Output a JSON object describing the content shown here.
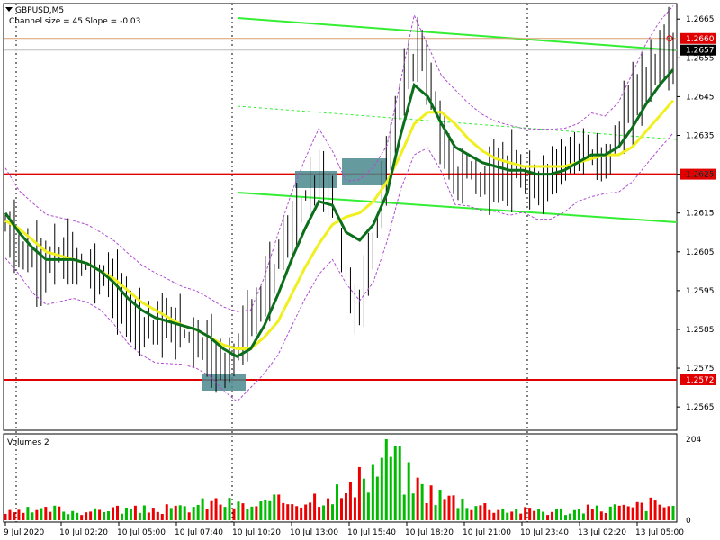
{
  "header": {
    "symbol": "GBPUSD,M5",
    "indicator": "Channel size = 45 Slope = -0.03",
    "volumes_label": "Volumes 2"
  },
  "colors": {
    "candle": "#000000",
    "level_line": "#e00000",
    "channel": "#33ee33",
    "ma_fast": "#0b6e1a",
    "ma_slow": "#f0f020",
    "envelope": "#b04cd0",
    "volume_up": "#00bb00",
    "volume_down": "#ee0000",
    "marker_box": "#4a8a8e",
    "current_line": "#d8a070"
  },
  "chart_data": [
    {
      "type": "candlestick",
      "title": "GBPUSD,M5",
      "x": [
        "9 Jul 2020",
        "10 Jul 02:20",
        "10 Jul 05:00",
        "10 Jul 07:40",
        "10 Jul 10:20",
        "10 Jul 13:00",
        "10 Jul 15:40",
        "10 Jul 18:20",
        "10 Jul 21:00",
        "10 Jul 23:40",
        "13 Jul 02:20",
        "13 Jul 05:00"
      ],
      "y_ticks": [
        "1.2665",
        "1.2655",
        "1.2645",
        "1.2635",
        "1.2625",
        "1.2615",
        "1.2605",
        "1.2595",
        "1.2585",
        "1.2575",
        "1.2565"
      ],
      "ylim": [
        1.2559,
        1.2669
      ],
      "levels": [
        {
          "label": "1.2660",
          "value": 1.266,
          "style": "current-ask"
        },
        {
          "label": "1.2657",
          "value": 1.2657,
          "style": "bid"
        },
        {
          "label": "1.2625",
          "value": 1.2625,
          "style": "level"
        },
        {
          "label": "1.2572",
          "value": 1.2572,
          "style": "level"
        }
      ],
      "closes": [
        1.2611,
        1.2607,
        1.2603,
        1.2601,
        1.2604,
        1.2603,
        1.2602,
        1.26,
        1.2598,
        1.2594,
        1.2589,
        1.2587,
        1.2586,
        1.2586,
        1.2585,
        1.2583,
        1.258,
        1.2576,
        1.2578,
        1.2584,
        1.259,
        1.2598,
        1.2606,
        1.2612,
        1.262,
        1.2624,
        1.2618,
        1.26,
        1.2588,
        1.2604,
        1.262,
        1.264,
        1.2652,
        1.2658,
        1.2645,
        1.263,
        1.2623,
        1.2627,
        1.2622,
        1.2625,
        1.2626,
        1.2624,
        1.2621,
        1.2624,
        1.2627,
        1.2632,
        1.263,
        1.2628,
        1.263,
        1.2638,
        1.2645,
        1.265,
        1.2655,
        1.2657
      ],
      "series": [
        {
          "name": "",
          "values": [
            1.2615,
            1.261,
            1.2606,
            1.2603,
            1.2603,
            1.2603,
            1.2602,
            1.26,
            1.2597,
            1.2593,
            1.259,
            1.2588,
            1.2587,
            1.2586,
            1.2585,
            1.2583,
            1.258,
            1.2578,
            1.258,
            1.2586,
            1.2594,
            1.2603,
            1.2611,
            1.2618,
            1.2617,
            1.261,
            1.2608,
            1.2612,
            1.262,
            1.2635,
            1.2648,
            1.2645,
            1.2638,
            1.2632,
            1.263,
            1.2628,
            1.2627,
            1.2626,
            1.2626,
            1.2625,
            1.2625,
            1.2626,
            1.2628,
            1.263,
            1.263,
            1.2632,
            1.2637,
            1.2643,
            1.2648,
            1.2652
          ]
        },
        {
          "name": "",
          "values": [
            1.2613,
            1.2611,
            1.2608,
            1.2605,
            1.2604,
            1.2603,
            1.2602,
            1.26,
            1.2598,
            1.2595,
            1.2592,
            1.259,
            1.2588,
            1.2586,
            1.2585,
            1.2583,
            1.2581,
            1.258,
            1.258,
            1.2583,
            1.2587,
            1.2594,
            1.2601,
            1.2607,
            1.2612,
            1.2614,
            1.2615,
            1.2618,
            1.2623,
            1.263,
            1.2638,
            1.2641,
            1.2641,
            1.2638,
            1.2634,
            1.2631,
            1.2629,
            1.2628,
            1.2627,
            1.2627,
            1.2627,
            1.2627,
            1.2628,
            1.2629,
            1.263,
            1.263,
            1.2632,
            1.2636,
            1.264,
            1.2644
          ]
        }
      ],
      "grid": false
    },
    {
      "type": "bar",
      "title": "Volumes 2",
      "y_ticks": [
        "204",
        "0"
      ],
      "ylim": [
        0,
        204
      ],
      "values": [
        20,
        18,
        25,
        22,
        30,
        28,
        24,
        26,
        22,
        35,
        30,
        28,
        26,
        32,
        30,
        28,
        34,
        40,
        45,
        50,
        42,
        38,
        36,
        44,
        48,
        52,
        55,
        60,
        70,
        80,
        65,
        90,
        110,
        150,
        204,
        130,
        100,
        85,
        70,
        60,
        55,
        48,
        40,
        35,
        30,
        28,
        25,
        30,
        22,
        26,
        24,
        28,
        30,
        32,
        36,
        30,
        40,
        45,
        38,
        42
      ]
    }
  ]
}
